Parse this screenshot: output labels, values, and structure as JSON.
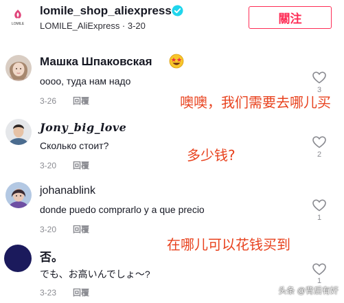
{
  "header": {
    "shop_name": "lomile_shop_aliexpress",
    "subtitle": "LOMILE_AliExpress · 3-20",
    "follow_label": "關注",
    "logo_text": "LOMILE"
  },
  "comments": [
    {
      "username": "Машка Шпаковская",
      "text": "оооо, туда нам надо",
      "date": "3-26",
      "reply": "回覆",
      "likes": "3"
    },
    {
      "username": "Jony_big_love",
      "text": "Сколько стоит?",
      "date": "3-20",
      "reply": "回覆",
      "likes": "2"
    },
    {
      "username": "johanablink",
      "text": "donde puedo comprarlo y a que precio",
      "date": "3-20",
      "reply": "回覆",
      "likes": "1"
    },
    {
      "username": "否。",
      "text": "でも、お高いんでしょ〜?",
      "date": "3-23",
      "reply": "回覆",
      "likes": "1"
    }
  ],
  "annotations": {
    "a1": "噢噢，我们需要去哪儿买",
    "a2": "多少钱?",
    "a3": "在哪儿可以花钱买到"
  },
  "watermark": "头条 @背后有奸",
  "colors": {
    "accent": "#fe2c55",
    "annotation": "#e8421e",
    "verified": "#20d5ec"
  },
  "icons": [
    "verified-badge-icon",
    "heart-outline-icon",
    "star-eyes-emoji-icon"
  ]
}
